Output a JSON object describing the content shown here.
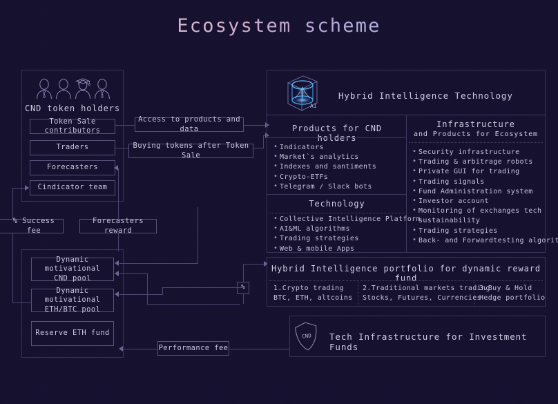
{
  "title": "Ecosystem scheme",
  "left": {
    "holders_title": "CND token holders",
    "people_icons": [
      "person-tie-icon",
      "person-icon",
      "person-graduate-icon",
      "person-tie-icon"
    ],
    "holder_boxes": [
      "Token Sale contributors",
      "Traders",
      "Forecasters",
      "Cindicator team"
    ],
    "fee_labels": {
      "success_fee": "% Success fee",
      "forecasters_reward": "Forecasters reward",
      "performance_fee": "Performance fee",
      "percent": "%"
    },
    "pools": [
      "Dynamic motivational\nCND pool",
      "Dynamic motivational\nETH/BTC pool",
      "Reserve ETH fund"
    ],
    "pool_lines": [
      [
        "Dynamic motivational",
        "CND pool"
      ],
      [
        "Dynamic motivational",
        "ETH/BTC pool"
      ],
      [
        "Reserve ETH fund",
        ""
      ]
    ]
  },
  "connectors": {
    "access": "Access to products and data",
    "buying": "Buying tokens after Token Sale"
  },
  "right": {
    "hit_header": "Hybrid Intelligence Technology",
    "hit_icon": "ai-cube-icon",
    "products_header": "Products for CND holders",
    "products": [
      "Indicators",
      "Market`s analytics",
      "Indexes and santiments",
      "Crypto-ETFs",
      "Telegram / Slack bots"
    ],
    "technology_header": "Technology",
    "technology": [
      "Collective Intelligence Platform",
      "AI&ML algorithms",
      "Trading strategies",
      "Web & mobile Apps"
    ],
    "infrastructure_header_line1": "Infrastructure",
    "infrastructure_header_line2": "and Products for Ecosystem",
    "infrastructure": [
      "Security infrastructure",
      "Trading & arbitrage robots",
      "Private GUI for trading",
      "Trading signals",
      "Fund Administration system",
      "Investor account",
      "Monitoring of exchanges tech",
      "sustainability",
      "Trading strategies",
      "Back- and Forwardtesting algorithms"
    ],
    "portfolio_header": "Hybrid Intelligence portfolio for dynamic reward fund",
    "portfolio": [
      {
        "title": "1.Crypto trading",
        "detail": "BTC, ETH, altcoins"
      },
      {
        "title": "2.Traditional markets trading",
        "detail": "Stocks, Futures, Currencies"
      },
      {
        "title": "3.Buy & Hold",
        "detail": "Hedge portfolio"
      }
    ],
    "funds_header": "Tech Infrastructure for Investment Funds",
    "funds_icon": "cnd-shield-icon",
    "funds_icon_label": "CND"
  },
  "colors": {
    "background": "#171130",
    "border": "#3a3358",
    "text": "#c8c6de",
    "accent_blue": "#4aa8ff",
    "line": "#4e4770"
  }
}
